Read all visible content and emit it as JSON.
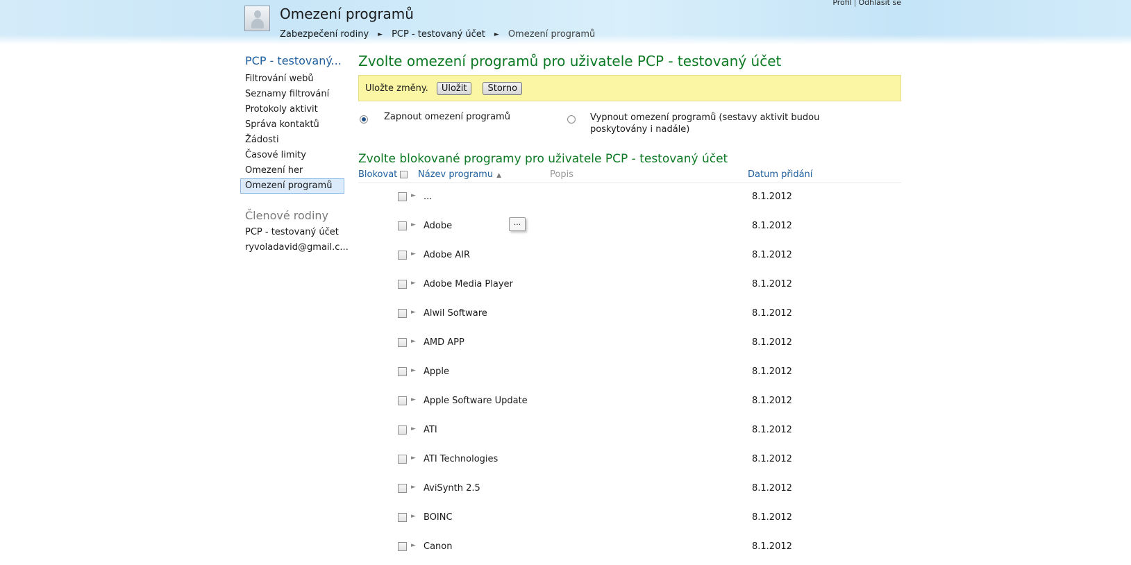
{
  "header": {
    "title": "Omezení programů",
    "breadcrumb": [
      "Zabezpečení rodiny",
      "PCP - testovaný účet",
      "Omezení programů"
    ],
    "breadcrumb_separator": "►",
    "links": {
      "profile": "Profil",
      "separator": "|",
      "logout": "Odhlásit se"
    }
  },
  "sidebar": {
    "account_heading": "PCP - testovaný...",
    "items": [
      {
        "label": "Filtrování webů"
      },
      {
        "label": "Seznamy filtrování"
      },
      {
        "label": "Protokoly aktivit"
      },
      {
        "label": "Správa kontaktů"
      },
      {
        "label": "Žádosti"
      },
      {
        "label": "Časové limity"
      },
      {
        "label": "Omezení her"
      },
      {
        "label": "Omezení programů",
        "selected": true
      }
    ],
    "family_heading": "Členové rodiny",
    "family_members": [
      "PCP - testovaný účet",
      "ryvoladavid@gmail.c..."
    ]
  },
  "main": {
    "title": "Zvolte omezení programů pro uživatele PCP - testovaný účet",
    "save_bar": {
      "text": "Uložte změny.",
      "save_label": "Uložit",
      "cancel_label": "Storno"
    },
    "radio_on": {
      "label": "Zapnout omezení programů",
      "checked": true
    },
    "radio_off": {
      "label": "Vypnout omezení programů (sestavy aktivit budou poskytovány i nadále)",
      "checked": false
    },
    "blocked_title": "Zvolte blokované programy pro uživatele PCP - testovaný účet",
    "columns": {
      "block": "Blokovat",
      "name": "Název programu",
      "sort_indicator": "▲",
      "description": "Popis",
      "date": "Datum přidání"
    },
    "expander_glyph": "►",
    "tooltip_button": "...",
    "programs": [
      {
        "name": "...",
        "date": "8.1.2012"
      },
      {
        "name": "Adobe",
        "date": "8.1.2012"
      },
      {
        "name": "Adobe AIR",
        "date": "8.1.2012"
      },
      {
        "name": "Adobe Media Player",
        "date": "8.1.2012"
      },
      {
        "name": "Alwil Software",
        "date": "8.1.2012"
      },
      {
        "name": "AMD APP",
        "date": "8.1.2012"
      },
      {
        "name": "Apple",
        "date": "8.1.2012"
      },
      {
        "name": "Apple Software Update",
        "date": "8.1.2012"
      },
      {
        "name": "ATI",
        "date": "8.1.2012"
      },
      {
        "name": "ATI Technologies",
        "date": "8.1.2012"
      },
      {
        "name": "AviSynth 2.5",
        "date": "8.1.2012"
      },
      {
        "name": "BOINC",
        "date": "8.1.2012"
      },
      {
        "name": "Canon",
        "date": "8.1.2012"
      }
    ]
  },
  "colors": {
    "heading_green": "#0d7a24",
    "link_blue": "#1e5f9e",
    "save_bar": "#fbf6a3"
  }
}
